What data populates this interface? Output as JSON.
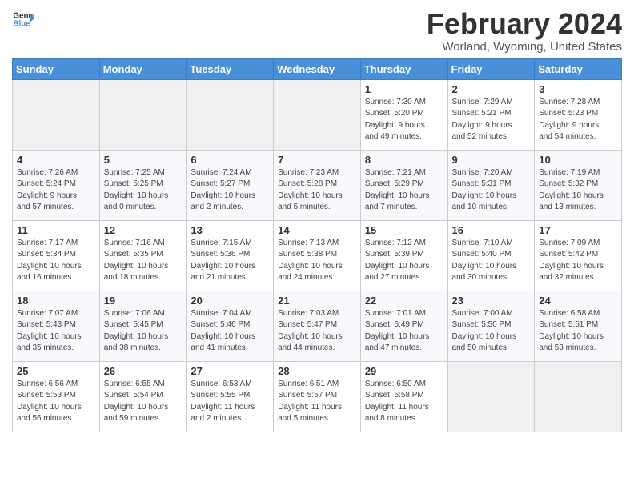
{
  "header": {
    "logo_line1": "General",
    "logo_line2": "Blue",
    "main_title": "February 2024",
    "subtitle": "Worland, Wyoming, United States"
  },
  "days_of_week": [
    "Sunday",
    "Monday",
    "Tuesday",
    "Wednesday",
    "Thursday",
    "Friday",
    "Saturday"
  ],
  "weeks": [
    [
      {
        "day": "",
        "info": ""
      },
      {
        "day": "",
        "info": ""
      },
      {
        "day": "",
        "info": ""
      },
      {
        "day": "",
        "info": ""
      },
      {
        "day": "1",
        "info": "Sunrise: 7:30 AM\nSunset: 5:20 PM\nDaylight: 9 hours\nand 49 minutes."
      },
      {
        "day": "2",
        "info": "Sunrise: 7:29 AM\nSunset: 5:21 PM\nDaylight: 9 hours\nand 52 minutes."
      },
      {
        "day": "3",
        "info": "Sunrise: 7:28 AM\nSunset: 5:23 PM\nDaylight: 9 hours\nand 54 minutes."
      }
    ],
    [
      {
        "day": "4",
        "info": "Sunrise: 7:26 AM\nSunset: 5:24 PM\nDaylight: 9 hours\nand 57 minutes."
      },
      {
        "day": "5",
        "info": "Sunrise: 7:25 AM\nSunset: 5:25 PM\nDaylight: 10 hours\nand 0 minutes."
      },
      {
        "day": "6",
        "info": "Sunrise: 7:24 AM\nSunset: 5:27 PM\nDaylight: 10 hours\nand 2 minutes."
      },
      {
        "day": "7",
        "info": "Sunrise: 7:23 AM\nSunset: 5:28 PM\nDaylight: 10 hours\nand 5 minutes."
      },
      {
        "day": "8",
        "info": "Sunrise: 7:21 AM\nSunset: 5:29 PM\nDaylight: 10 hours\nand 7 minutes."
      },
      {
        "day": "9",
        "info": "Sunrise: 7:20 AM\nSunset: 5:31 PM\nDaylight: 10 hours\nand 10 minutes."
      },
      {
        "day": "10",
        "info": "Sunrise: 7:19 AM\nSunset: 5:32 PM\nDaylight: 10 hours\nand 13 minutes."
      }
    ],
    [
      {
        "day": "11",
        "info": "Sunrise: 7:17 AM\nSunset: 5:34 PM\nDaylight: 10 hours\nand 16 minutes."
      },
      {
        "day": "12",
        "info": "Sunrise: 7:16 AM\nSunset: 5:35 PM\nDaylight: 10 hours\nand 18 minutes."
      },
      {
        "day": "13",
        "info": "Sunrise: 7:15 AM\nSunset: 5:36 PM\nDaylight: 10 hours\nand 21 minutes."
      },
      {
        "day": "14",
        "info": "Sunrise: 7:13 AM\nSunset: 5:38 PM\nDaylight: 10 hours\nand 24 minutes."
      },
      {
        "day": "15",
        "info": "Sunrise: 7:12 AM\nSunset: 5:39 PM\nDaylight: 10 hours\nand 27 minutes."
      },
      {
        "day": "16",
        "info": "Sunrise: 7:10 AM\nSunset: 5:40 PM\nDaylight: 10 hours\nand 30 minutes."
      },
      {
        "day": "17",
        "info": "Sunrise: 7:09 AM\nSunset: 5:42 PM\nDaylight: 10 hours\nand 32 minutes."
      }
    ],
    [
      {
        "day": "18",
        "info": "Sunrise: 7:07 AM\nSunset: 5:43 PM\nDaylight: 10 hours\nand 35 minutes."
      },
      {
        "day": "19",
        "info": "Sunrise: 7:06 AM\nSunset: 5:45 PM\nDaylight: 10 hours\nand 38 minutes."
      },
      {
        "day": "20",
        "info": "Sunrise: 7:04 AM\nSunset: 5:46 PM\nDaylight: 10 hours\nand 41 minutes."
      },
      {
        "day": "21",
        "info": "Sunrise: 7:03 AM\nSunset: 5:47 PM\nDaylight: 10 hours\nand 44 minutes."
      },
      {
        "day": "22",
        "info": "Sunrise: 7:01 AM\nSunset: 5:49 PM\nDaylight: 10 hours\nand 47 minutes."
      },
      {
        "day": "23",
        "info": "Sunrise: 7:00 AM\nSunset: 5:50 PM\nDaylight: 10 hours\nand 50 minutes."
      },
      {
        "day": "24",
        "info": "Sunrise: 6:58 AM\nSunset: 5:51 PM\nDaylight: 10 hours\nand 53 minutes."
      }
    ],
    [
      {
        "day": "25",
        "info": "Sunrise: 6:56 AM\nSunset: 5:53 PM\nDaylight: 10 hours\nand 56 minutes."
      },
      {
        "day": "26",
        "info": "Sunrise: 6:55 AM\nSunset: 5:54 PM\nDaylight: 10 hours\nand 59 minutes."
      },
      {
        "day": "27",
        "info": "Sunrise: 6:53 AM\nSunset: 5:55 PM\nDaylight: 11 hours\nand 2 minutes."
      },
      {
        "day": "28",
        "info": "Sunrise: 6:51 AM\nSunset: 5:57 PM\nDaylight: 11 hours\nand 5 minutes."
      },
      {
        "day": "29",
        "info": "Sunrise: 6:50 AM\nSunset: 5:58 PM\nDaylight: 11 hours\nand 8 minutes."
      },
      {
        "day": "",
        "info": ""
      },
      {
        "day": "",
        "info": ""
      }
    ]
  ]
}
